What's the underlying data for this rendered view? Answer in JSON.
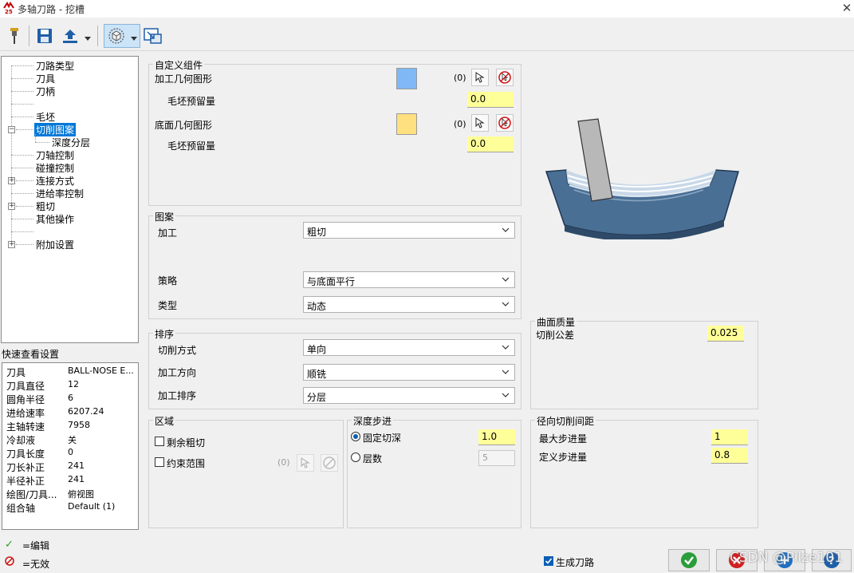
{
  "window": {
    "title": "多轴刀路 - 挖槽",
    "logo": "25",
    "close_icon": "close-icon"
  },
  "toolbar": {
    "icons": [
      "tool-icon",
      "save-icon",
      "export-icon",
      "dropdown-arrow-icon",
      "view-cube-icon",
      "dropdown-arrow-icon",
      "screen-resize-icon"
    ]
  },
  "tree": {
    "items": [
      {
        "label": "刀路类型",
        "expander": ""
      },
      {
        "label": "刀具",
        "expander": ""
      },
      {
        "label": "刀柄",
        "expander": ""
      },
      {
        "label": "",
        "expander": ""
      },
      {
        "label": "毛坯",
        "expander": ""
      },
      {
        "label": "切削图案",
        "expander": "−"
      },
      {
        "label": "深度分层",
        "expander": ""
      },
      {
        "label": "刀轴控制",
        "expander": ""
      },
      {
        "label": "碰撞控制",
        "expander": ""
      },
      {
        "label": "连接方式",
        "expander": "+"
      },
      {
        "label": "进给率控制",
        "expander": ""
      },
      {
        "label": "粗切",
        "expander": "+"
      },
      {
        "label": "其他操作",
        "expander": ""
      },
      {
        "label": "",
        "expander": ""
      },
      {
        "label": "附加设置",
        "expander": "+"
      }
    ]
  },
  "quick_view": {
    "title": "快速查看设置",
    "rows": [
      {
        "key": "刀具",
        "value": "BALL-NOSE E..."
      },
      {
        "key": "刀具直径",
        "value": "12"
      },
      {
        "key": "圆角半径",
        "value": "6"
      },
      {
        "key": "进给速率",
        "value": "6207.24"
      },
      {
        "key": "主轴转速",
        "value": "7958"
      },
      {
        "key": "冷却液",
        "value": "关"
      },
      {
        "key": "刀具长度",
        "value": "0"
      },
      {
        "key": "刀长补正",
        "value": "241"
      },
      {
        "key": "半径补正",
        "value": "241"
      },
      {
        "key": "绘图/刀具...",
        "value": "俯视图"
      },
      {
        "key": "组合轴",
        "value": "Default (1)"
      }
    ]
  },
  "legend": {
    "edit": "=编辑",
    "invalid": "=无效"
  },
  "custom_group": {
    "title": "自定义组件",
    "machining_geometry": {
      "label": "加工几何图形",
      "count": "(0)",
      "color": "#7fb8f5",
      "stock_label": "毛坯预留量",
      "stock_value": "0.0"
    },
    "floor_geometry": {
      "label": "底面几何图形",
      "count": "(0)",
      "color": "#ffe080",
      "stock_label": "毛坯预留量",
      "stock_value": "0.0"
    }
  },
  "pattern": {
    "title": "图案",
    "machining": {
      "label": "加工",
      "value": "粗切"
    },
    "strategy": {
      "label": "策略",
      "value": "与底面平行"
    },
    "type": {
      "label": "类型",
      "value": "动态"
    }
  },
  "sorting": {
    "title": "排序",
    "cut_method": {
      "label": "切削方式",
      "value": "单向"
    },
    "direction": {
      "label": "加工方向",
      "value": "顺铣"
    },
    "order": {
      "label": "加工排序",
      "value": "分层"
    }
  },
  "region": {
    "title": "区域",
    "remaining_rough": {
      "label": "剩余粗切",
      "checked": false
    },
    "constraint": {
      "label": "约束范围",
      "checked": false,
      "count": "(0)"
    }
  },
  "depth_step": {
    "title": "深度步进",
    "fixed": {
      "label": "固定切深",
      "value": "1.0",
      "selected": true
    },
    "layers": {
      "label": "层数",
      "value": "5",
      "selected": false
    }
  },
  "surface_quality": {
    "title": "曲面质量",
    "tolerance_label": "切削公差",
    "tolerance_value": "0.025"
  },
  "radial_step": {
    "title": "径向切削间距",
    "max_label": "最大步进量",
    "max_value": "1",
    "def_label": "定义步进量",
    "def_value": "0.8"
  },
  "footer": {
    "generate_label": "生成刀路",
    "generate_checked": true,
    "watermark": "CSDN @Pilze101"
  }
}
